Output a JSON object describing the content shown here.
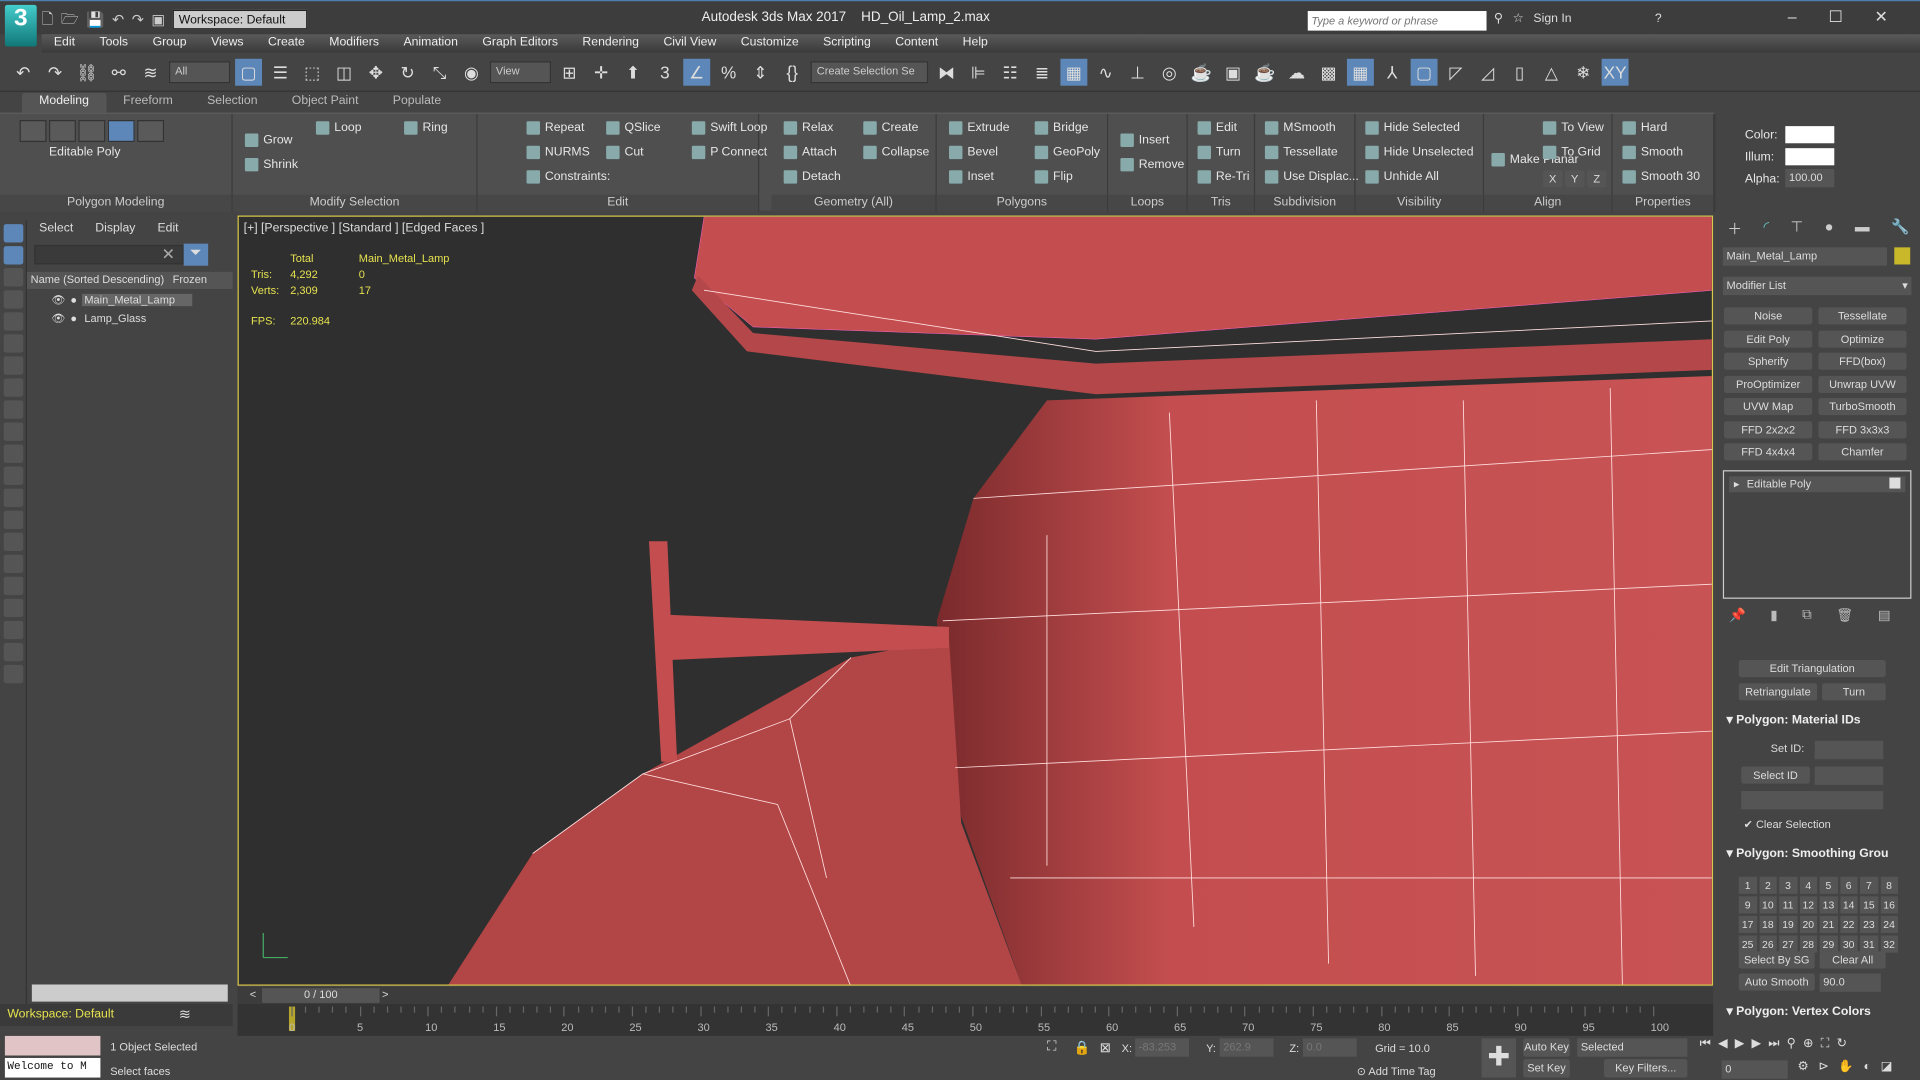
{
  "app": {
    "title": "Autodesk 3ds Max 2017",
    "file": "HD_Oil_Lamp_2.max",
    "logo": "3",
    "workspace": "Workspace: Default",
    "search_placeholder": "Type a keyword or phrase",
    "sign_in": "Sign In"
  },
  "menu": [
    "Edit",
    "Tools",
    "Group",
    "Views",
    "Create",
    "Modifiers",
    "Animation",
    "Graph Editors",
    "Rendering",
    "Civil View",
    "Customize",
    "Scripting",
    "Content",
    "Help"
  ],
  "toolbar": {
    "filter": "All",
    "ref_coord": "View",
    "selection_set": "Create Selection Se"
  },
  "ribbon_tabs": [
    "Modeling",
    "Freeform",
    "Selection",
    "Object Paint",
    "Populate"
  ],
  "ribbon": {
    "polygon_modeling": {
      "label": "Polygon Modeling",
      "object": "Editable Poly"
    },
    "modify_selection": {
      "label": "Modify Selection",
      "grow": "Grow",
      "shrink": "Shrink",
      "loop": "Loop",
      "ring": "Ring"
    },
    "edit": {
      "label": "Edit",
      "items": [
        "Repeat",
        "QSlice",
        "Swift Loop",
        "NURMS",
        "Cut",
        "P Connect"
      ],
      "constraints": "Constraints:"
    },
    "geometry": {
      "label": "Geometry (All)",
      "items": [
        "Relax",
        "Create",
        "Attach",
        "Collapse",
        "Detach"
      ]
    },
    "polygons": {
      "label": "Polygons",
      "items": [
        "Extrude",
        "Bridge",
        "Bevel",
        "GeoPoly",
        "Inset",
        "Flip"
      ]
    },
    "loops": {
      "label": "Loops",
      "items": [
        "Insert",
        "Remove"
      ]
    },
    "tris": {
      "label": "Tris",
      "items": [
        "Edit",
        "Turn",
        "Re-Tri"
      ]
    },
    "subdivision": {
      "label": "Subdivision",
      "items": [
        "MSmooth",
        "Tessellate",
        "Use Displac..."
      ]
    },
    "visibility": {
      "label": "Visibility",
      "items": [
        "Hide Selected",
        "Hide Unselected",
        "Unhide All"
      ]
    },
    "align": {
      "label": "Align",
      "make_planar": "Make Planar",
      "items": [
        "To View",
        "To Grid"
      ],
      "axes": [
        "X",
        "Y",
        "Z"
      ]
    },
    "properties": {
      "label": "Properties",
      "items": [
        "Hard",
        "Smooth",
        "Smooth 30"
      ],
      "color": "Color:",
      "illum": "Illum:",
      "alpha": "Alpha:",
      "alpha_value": "100.00"
    }
  },
  "explorer": {
    "menu": [
      "Select",
      "Display",
      "Edit"
    ],
    "col_name": "Name (Sorted Descending)",
    "col_frozen": "Frozen",
    "rows": [
      {
        "name": "Main_Metal_Lamp",
        "selected": true
      },
      {
        "name": "Lamp_Glass",
        "selected": false
      }
    ],
    "workspace": "Workspace: Default"
  },
  "viewport": {
    "label": "[+] [Perspective ] [Standard ] [Edged Faces ]",
    "stats": {
      "total": "Total",
      "object": "Main_Metal_Lamp",
      "tris_label": "Tris:",
      "tris_total": "4,292",
      "tris_obj": "0",
      "verts_label": "Verts:",
      "verts_total": "2,309",
      "verts_obj": "17",
      "fps_label": "FPS:",
      "fps": "220.984"
    },
    "object_color": "#c44e4f"
  },
  "command_panel": {
    "object_name": "Main_Metal_Lamp",
    "object_color": "#c8b82a",
    "modifier_list": "Modifier List",
    "modifiers": [
      "Noise",
      "Tessellate",
      "Edit Poly",
      "Optimize",
      "Spherify",
      "FFD(box)",
      "ProOptimizer",
      "Unwrap UVW",
      "UVW Map",
      "TurboSmooth",
      "FFD 2x2x2",
      "FFD 3x3x3",
      "FFD 4x4x4",
      "Chamfer"
    ],
    "stack": [
      "Editable Poly"
    ],
    "edit_triangulation": "Edit Triangulation",
    "retriangulate": "Retriangulate",
    "turn": "Turn",
    "material_ids": {
      "title": "Polygon: Material IDs",
      "set_id": "Set ID:",
      "select_id": "Select ID",
      "clear_selection": "Clear Selection",
      "clear_selection_checked": true
    },
    "smoothing": {
      "title": "Polygon: Smoothing Grou",
      "groups": [
        "1",
        "2",
        "3",
        "4",
        "5",
        "6",
        "7",
        "8",
        "9",
        "10",
        "11",
        "12",
        "13",
        "14",
        "15",
        "16",
        "17",
        "18",
        "19",
        "20",
        "21",
        "22",
        "23",
        "24",
        "25",
        "26",
        "27",
        "28",
        "29",
        "30",
        "31",
        "32"
      ],
      "select_by_sg": "Select By SG",
      "clear_all": "Clear All",
      "auto_smooth": "Auto Smooth",
      "auto_smooth_value": "90.0"
    },
    "vertex_colors": {
      "title": "Polygon: Vertex Colors"
    }
  },
  "timeline": {
    "frame": "0 / 100",
    "ticks": [
      "0",
      "5",
      "10",
      "15",
      "20",
      "25",
      "30",
      "35",
      "40",
      "45",
      "50",
      "55",
      "60",
      "65",
      "70",
      "75",
      "80",
      "85",
      "90",
      "95",
      "100"
    ]
  },
  "status": {
    "selected": "1 Object Selected",
    "prompt": "Select faces",
    "maxscript": "Welcome to M",
    "x_label": "X:",
    "x": "-83.253",
    "y_label": "Y:",
    "y": "262.9",
    "z_label": "Z:",
    "z": "0.0",
    "grid": "Grid = 10.0",
    "add_time_tag": "Add Time Tag",
    "auto_key": "Auto Key",
    "set_key": "Set Key",
    "key_mode": "Selected",
    "key_filters": "Key Filters...",
    "current_frame": "0"
  }
}
